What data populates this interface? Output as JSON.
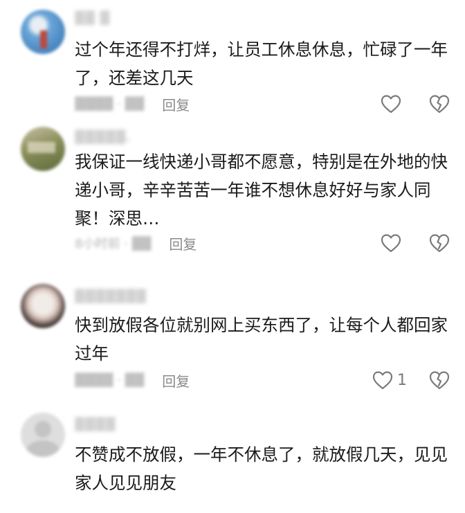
{
  "comments": [
    {
      "username": "▓▓ ▓",
      "content": "过个年还得不打烊，让员工休息休息，忙碌了一年了，还差这几天",
      "meta": "▓▓▓▓ · ▓▓",
      "reply_label": "回复",
      "likes": "",
      "avatar_colors": [
        "#6aa6d8",
        "#b94a3f",
        "#e8eef3"
      ]
    },
    {
      "username": "▓▓▓▓▓、",
      "content": "我保证一线快递小哥都不愿意，特别是在外地的快递小哥，辛辛苦苦一年谁不想休息好好与家人同聚！深思…",
      "meta": "8小时前 · ▓▓",
      "reply_label": "回复",
      "likes": "",
      "avatar_colors": [
        "#8a8f5a",
        "#c9c2a8",
        "#5d6b3c"
      ]
    },
    {
      "username": "▓▓▓▓▓▓▓",
      "content": "快到放假各位就别网上买东西了，让每个人都回家过年",
      "meta": "▓▓▓▓ · ▓▓",
      "reply_label": "回复",
      "likes": "1",
      "avatar_colors": [
        "#f1ece8",
        "#3b2f2c",
        "#d9c3bb"
      ]
    },
    {
      "username": "▓▓▓▓",
      "content": "不赞成不放假，一年不休息了，就放假几天，见见家人见见朋友",
      "meta": "",
      "reply_label": "",
      "likes": "",
      "avatar_colors": [
        "#d4d4d4",
        "#bfbfbf",
        "#e6e6e6"
      ]
    }
  ],
  "icons": {
    "like": "heart-outline-icon",
    "dislike": "broken-heart-outline-icon",
    "icon_color": "#7a7a7a"
  }
}
